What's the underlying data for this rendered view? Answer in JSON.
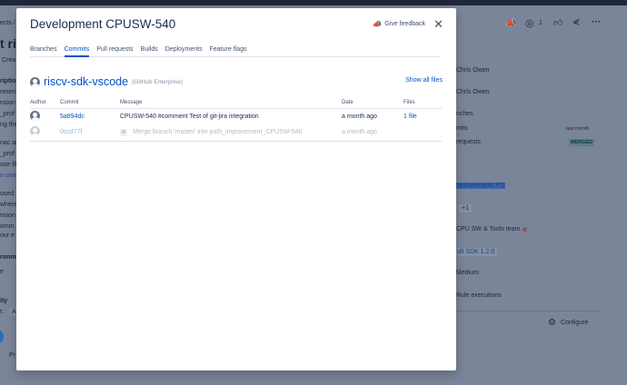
{
  "modal": {
    "title": "Development CPUSW-540",
    "feedback_label": "Give feedback",
    "tabs": [
      "Branches",
      "Commits",
      "Pull requests",
      "Builds",
      "Deployments",
      "Feature flags"
    ],
    "active_tab": "Commits",
    "repo": {
      "name": "riscv-sdk-vscode",
      "source": "(GitHub Enterprise)",
      "show_all": "Show all files"
    },
    "columns": [
      "Author",
      "Commit",
      "Message",
      "Date",
      "Files"
    ],
    "commits": [
      {
        "hash": "5a894dc",
        "badge": "",
        "message": "CPUSW-540 #comment Test of git-jira integration",
        "date": "a month ago",
        "files": "1 file"
      },
      {
        "hash": "0ccd77f",
        "badge": "M",
        "message": "Merge branch 'master' into path_improvement_CPUSW-540",
        "date": "a month ago",
        "files": ""
      }
    ]
  },
  "background_left": [
    "ects /",
    "t ric",
    "Crea",
    "riptio",
    "resent",
    "nsion",
    "_prof",
    "ng the",
    "nac ar",
    "_prof",
    "ose fil",
    "n usin",
    "osed",
    "where",
    "nsion",
    "omm",
    "our e",
    "ronme",
    "e",
    "ity",
    "r:",
    "A",
    "Pr"
  ],
  "background_right": {
    "watch_count": "1",
    "assignee": "Chris Owen",
    "reporter": "Chris Owen",
    "dev": [
      "nches",
      "mits",
      "requests"
    ],
    "last_commit": "last month",
    "pr_status": "MERGED",
    "sprint": "mprovements PI1",
    "plus": "+1",
    "team": "CPU SW & Tools team",
    "fix_version": "ult SDK 1.2.0",
    "priority": "Medium",
    "rules": "Rule executions",
    "configure": "Configure"
  }
}
